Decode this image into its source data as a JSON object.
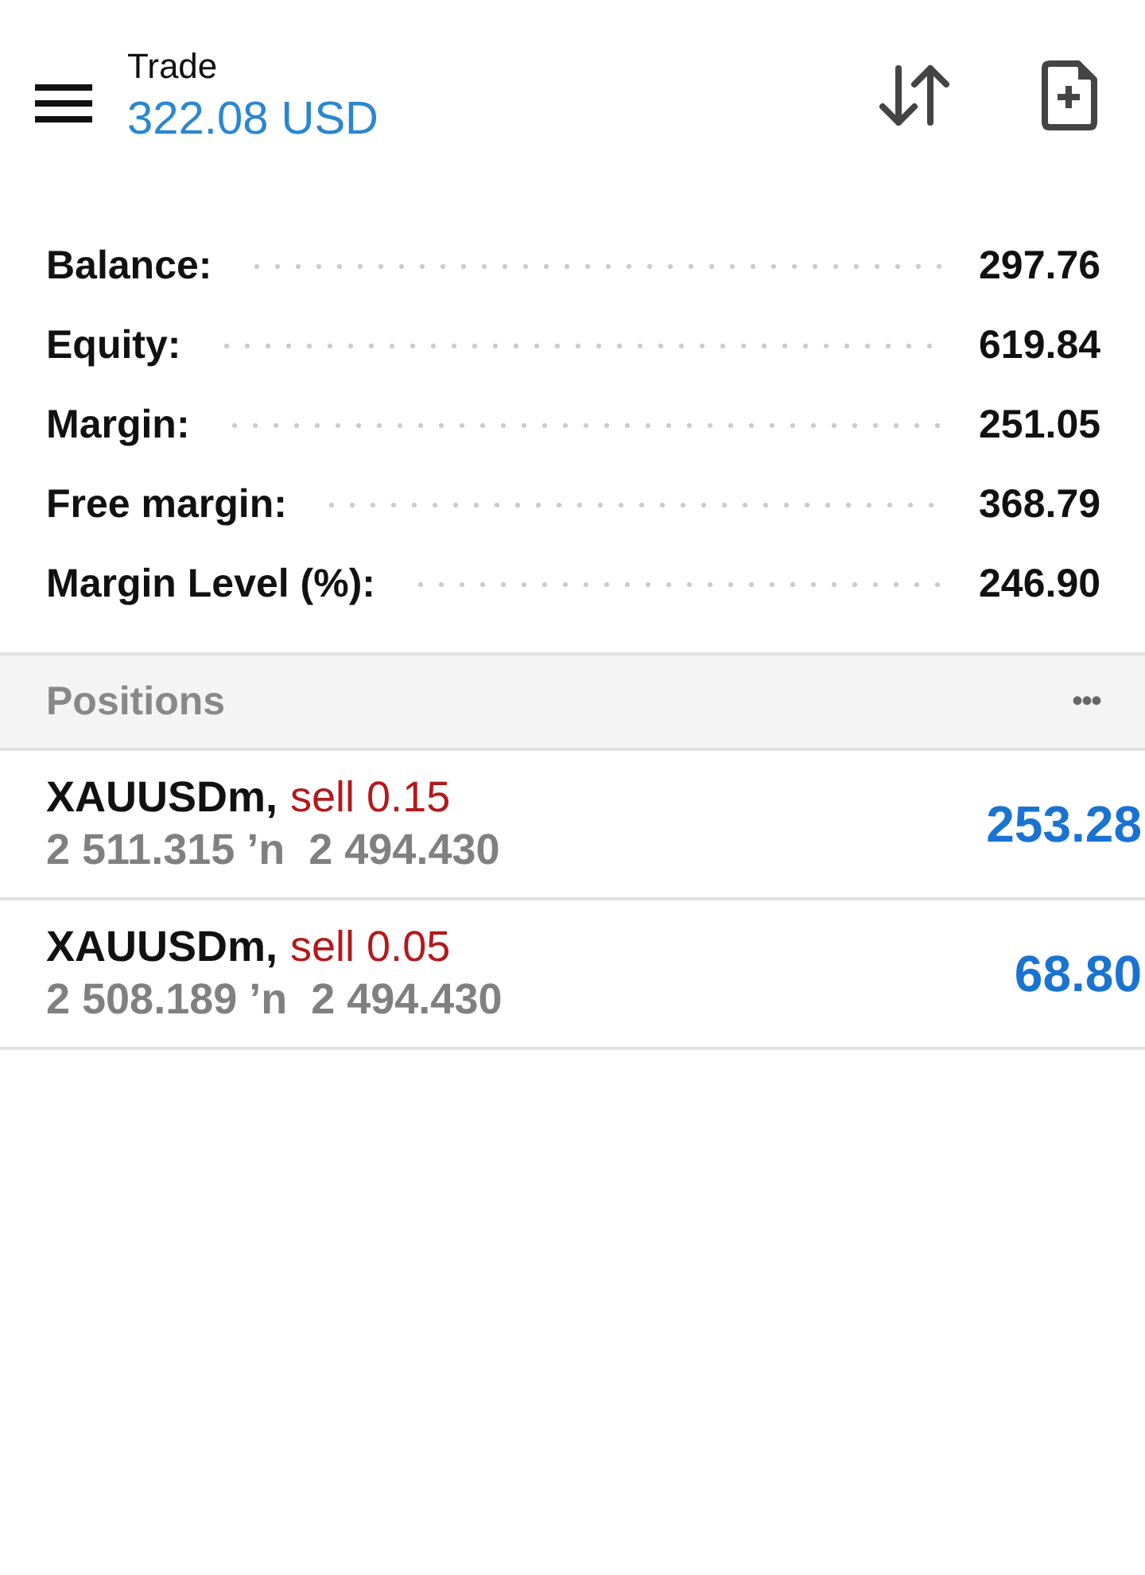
{
  "header": {
    "title": "Trade",
    "amount": "322.08 USD"
  },
  "summary": [
    {
      "label": "Balance:",
      "value": "297.76"
    },
    {
      "label": "Equity:",
      "value": "619.84"
    },
    {
      "label": "Margin:",
      "value": "251.05"
    },
    {
      "label": "Free margin:",
      "value": "368.79"
    },
    {
      "label": "Margin Level (%):",
      "value": "246.90"
    }
  ],
  "positions_header": {
    "title": "Positions",
    "menu": "•••"
  },
  "positions": [
    {
      "symbol": "XAUUSDm,",
      "order": "sell 0.15",
      "prices": "2 511.315 ʼn  2 494.430",
      "profit": "253.28"
    },
    {
      "symbol": "XAUUSDm,",
      "order": "sell 0.05",
      "prices": "2 508.189 ʼn  2 494.430",
      "profit": "68.80"
    }
  ]
}
